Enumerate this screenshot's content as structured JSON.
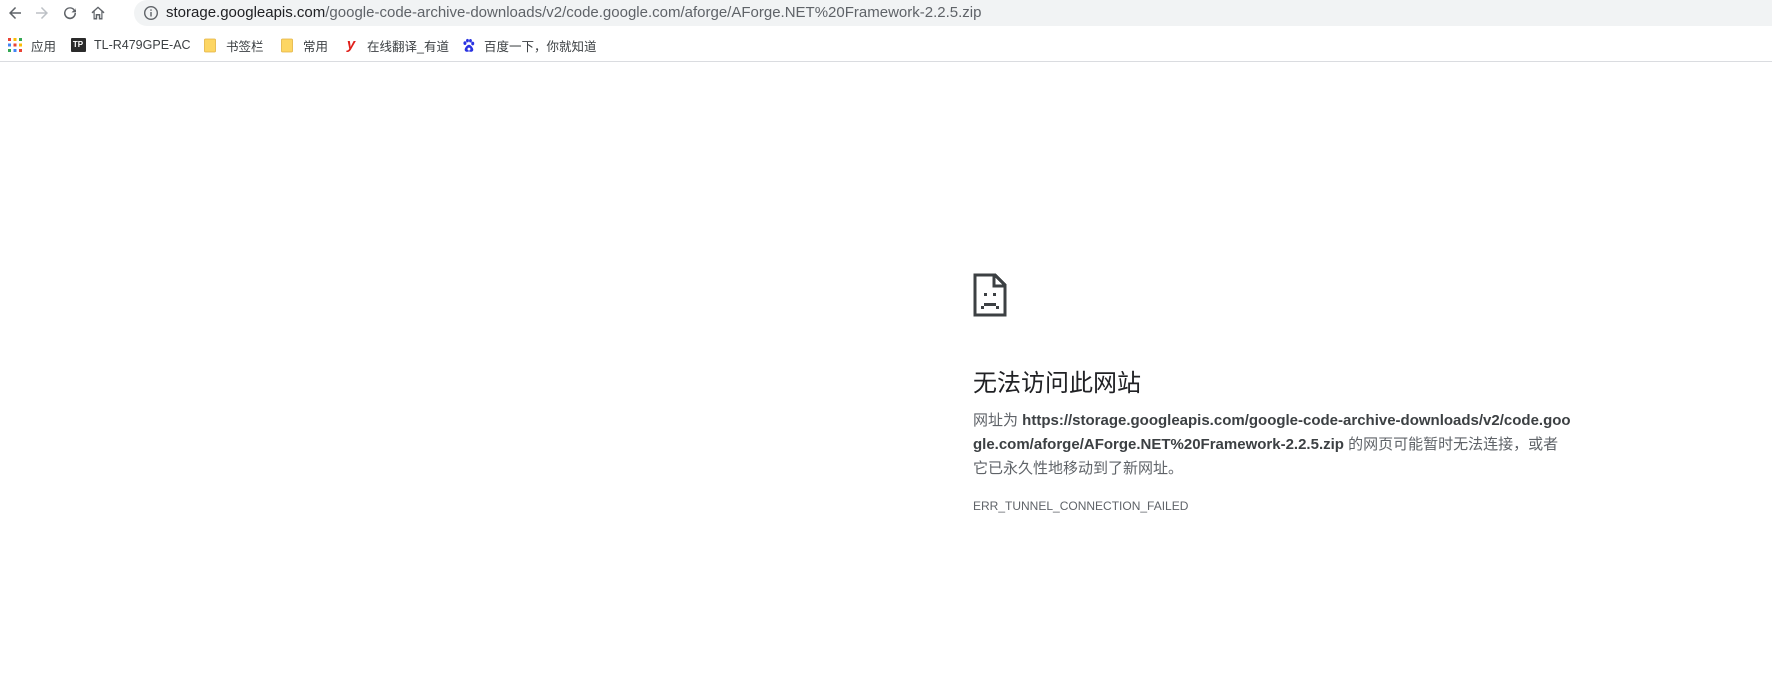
{
  "toolbar": {
    "back_icon": "arrow-left-icon",
    "forward_icon": "arrow-right-icon",
    "reload_icon": "reload-icon",
    "home_icon": "home-icon"
  },
  "omnibox": {
    "info_icon": "info-icon",
    "url_host": "storage.googleapis.com",
    "url_path": "/google-code-archive-downloads/v2/code.google.com/aforge/AForge.NET%20Framework-2.2.5.zip"
  },
  "bookmarks": [
    {
      "label": "应用",
      "icon": "apps-grid-icon"
    },
    {
      "label": "TL-R479GPE-AC",
      "icon": "tp-link-icon",
      "icon_text": "TP"
    },
    {
      "label": "书签栏",
      "icon": "folder-icon"
    },
    {
      "label": "常用",
      "icon": "folder-icon"
    },
    {
      "label": "在线翻译_有道",
      "icon": "youdao-icon",
      "icon_text": "y"
    },
    {
      "label": "百度一下，你就知道",
      "icon": "baidu-paw-icon"
    }
  ],
  "error": {
    "icon": "sad-page-icon",
    "title": "无法访问此网站",
    "desc_prefix": "网址为 ",
    "desc_url": "https://storage.googleapis.com/google-code-archive-downloads/v2/code.google.com/aforge/AForge.NET%20Framework-2.2.5.zip",
    "desc_suffix": " 的网页可能暂时无法连接，或者它已永久性地移动到了新网址。",
    "error_code": "ERR_TUNNEL_CONNECTION_FAILED"
  },
  "colors": {
    "folder": "#fdd663",
    "youdao": "#e0201b",
    "baidu": "#2932e1",
    "omnibox_bg": "#f1f3f4"
  }
}
